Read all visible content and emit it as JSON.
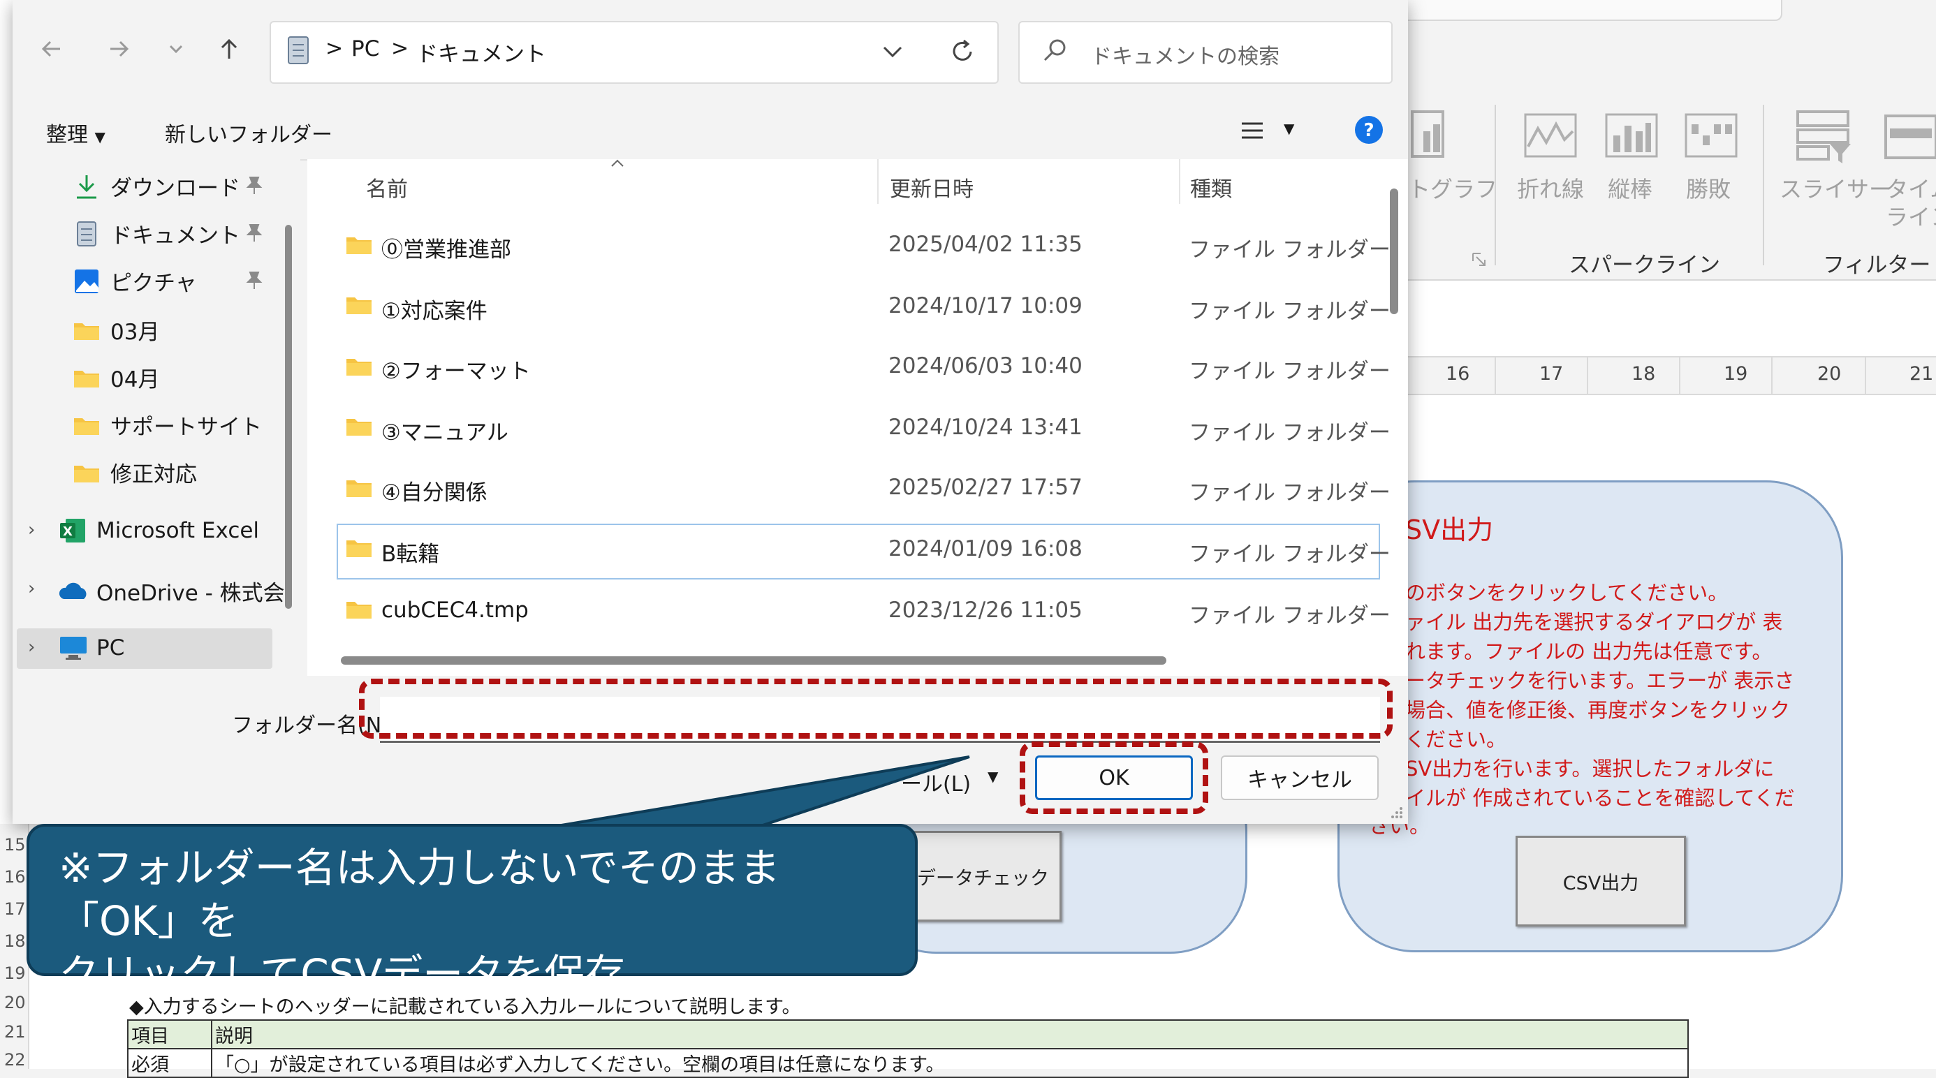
{
  "dialog": {
    "nav": {
      "back_icon": "arrow-left-icon",
      "forward_icon": "arrow-right-icon",
      "recent_icon": "chevron-down-icon",
      "up_icon": "arrow-up-icon"
    },
    "address": {
      "segment1": "PC",
      "separator": ">",
      "segment2": "ドキュメント"
    },
    "search_placeholder": "ドキュメントの検索",
    "commands": {
      "organize": "整理",
      "new_folder": "新しいフォルダー"
    },
    "nav_pane": [
      {
        "label": "ダウンロード",
        "icon": "download-icon",
        "pinned": true
      },
      {
        "label": "ドキュメント",
        "icon": "document-icon",
        "pinned": true
      },
      {
        "label": "ピクチャ",
        "icon": "picture-icon",
        "pinned": true
      },
      {
        "label": "03月",
        "icon": "folder-icon"
      },
      {
        "label": "04月",
        "icon": "folder-icon"
      },
      {
        "label": "サポートサイト",
        "icon": "folder-icon"
      },
      {
        "label": "修正対応",
        "icon": "folder-icon"
      },
      {
        "label": "Microsoft Excel",
        "icon": "excel-icon"
      },
      {
        "label": "OneDrive - 株式会",
        "icon": "onedrive-icon"
      },
      {
        "label": "PC",
        "icon": "pc-icon",
        "selected": true
      }
    ],
    "columns": {
      "name": "名前",
      "date": "更新日時",
      "type": "種類"
    },
    "files": [
      {
        "name": "⓪営業推進部",
        "date": "2025/04/02 11:35",
        "type": "ファイル フォルダー"
      },
      {
        "name": "①対応案件",
        "date": "2024/10/17 10:09",
        "type": "ファイル フォルダー"
      },
      {
        "name": "②フォーマット",
        "date": "2024/06/03 10:40",
        "type": "ファイル フォルダー"
      },
      {
        "name": "③マニュアル",
        "date": "2024/10/24 13:41",
        "type": "ファイル フォルダー"
      },
      {
        "name": "④自分関係",
        "date": "2025/02/27 17:57",
        "type": "ファイル フォルダー"
      },
      {
        "name": "B転籍",
        "date": "2024/01/09 16:08",
        "type": "ファイル フォルダー",
        "selected": true
      },
      {
        "name": "cubCEC4.tmp",
        "date": "2023/12/26 11:05",
        "type": "ファイル フォルダー"
      }
    ],
    "folder_label": "フォルダー名(N):",
    "folder_value": "",
    "tools_label": "ール(L)",
    "ok_label": "OK",
    "cancel_label": "キャンセル"
  },
  "callout": {
    "text": "※フォルダー名は入力しないでそのまま「OK」を\nクリックしてCSVデータを保存"
  },
  "excel": {
    "ribbon": {
      "partial_chart_label": "トグラフ",
      "sparkline_items": [
        "折れ線",
        "縦棒",
        "勝敗"
      ],
      "sparkline_group": "スパークライン",
      "slicer": "スライサー",
      "timeline_1": "タイム",
      "timeline_2": "ライン",
      "filter_group": "フィルター"
    },
    "column_headers": [
      "16",
      "17",
      "18",
      "19",
      "20",
      "21"
    ],
    "row_headers": [
      "15",
      "16",
      "17",
      "18",
      "19",
      "20",
      "21",
      "22"
    ],
    "csv_panel": {
      "title": "SV出力",
      "lines": [
        "のボタンをクリックしてください。",
        "ァイル 出力先を選択するダイアログが 表",
        "れます。ファイルの 出力先は任意です。",
        "ータチェックを行います。エラーが 表示さ",
        "場合、値を修正後、再度ボタンをクリック",
        "ください。",
        "SV出力を行います。選択したフォルダに",
        "イルが 作成されていることを確認してくだ",
        "さい。"
      ],
      "button": "CSV出力"
    },
    "check_button": "データチェック",
    "description": "◆入力するシートのヘッダーに記載されている入力ルールについて説明します。",
    "table_header": [
      "項目",
      "説明"
    ],
    "table_row": [
      "必須",
      "「○」が設定されている項目は必ず入力してください。空欄の項目は任意になります。"
    ]
  }
}
